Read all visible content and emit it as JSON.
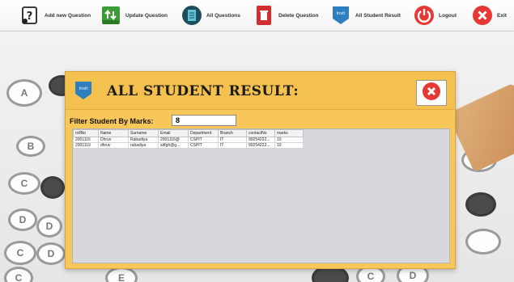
{
  "toolbar": {
    "items": [
      {
        "label": "Add new Question"
      },
      {
        "label": "Update Question"
      },
      {
        "label": "All Questions"
      },
      {
        "label": "Delete Question"
      },
      {
        "label": "All Student Result"
      },
      {
        "label": "Logout"
      },
      {
        "label": "Exit"
      }
    ]
  },
  "dialog": {
    "title": "ALL STUDENT RESULT:",
    "badge_text": "Insit",
    "filter_label": "Filter Student By Marks:",
    "filter_value": "8"
  },
  "table": {
    "columns": [
      "rollNo",
      "Name",
      "Surname",
      "Email",
      "Department",
      "Branch",
      "contactNo",
      "marks"
    ],
    "rows": [
      [
        "2001116",
        "Dhruv",
        "Rabadiya",
        "2001116@",
        "CSPIT",
        "IT",
        "99254222...",
        "10"
      ],
      [
        "2001119",
        "dhruv",
        "rabadiya",
        "sdfgh@g...",
        "CSPIT",
        "IT",
        "99254222...",
        "10"
      ]
    ]
  },
  "background": {
    "bubble_letters": [
      "A",
      "B",
      "C",
      "D",
      "E"
    ]
  },
  "colors": {
    "dialog_bg": "#f8c75a",
    "close_red": "#e53935",
    "grid_bg": "#d7d8dc"
  }
}
